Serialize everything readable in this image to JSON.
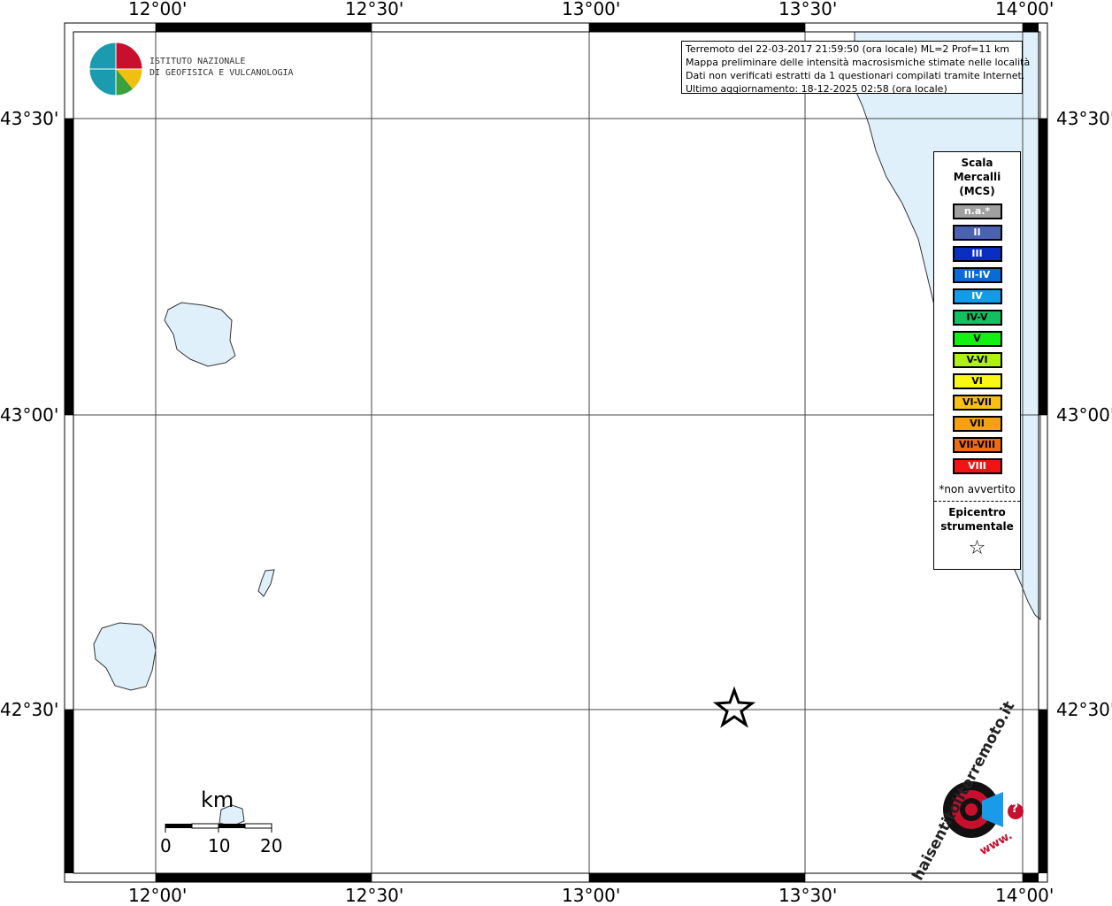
{
  "map": {
    "top_labels": [
      "12°00'",
      "12°30'",
      "13°00'",
      "13°30'",
      "14°00'"
    ],
    "bottom_labels": [
      "12°00'",
      "12°30'",
      "13°00'",
      "13°30'",
      "14°00'"
    ],
    "left_labels": [
      "43°30'",
      "43°00'",
      "42°30'"
    ],
    "right_labels": [
      "43°30'",
      "43°00'",
      "42°30'"
    ],
    "sea_color": "#e0f0fa",
    "grid_color": "#444444"
  },
  "info": {
    "line1": "Terremoto del 22-03-2017 21:59:50 (ora locale) ML=2 Prof=11 km",
    "line2": "Mappa preliminare delle intensità macrosismiche stimate nelle località",
    "line3": "Dati non verificati estratti da 1 questionari compilati tramite Internet.",
    "line4": "Ultimo aggiornamento: 18-12-2025 02:58 (ora locale)"
  },
  "logo": {
    "line1": "ISTITUTO NAZIONALE",
    "line2": "DI GEOFISICA E VULCANOLOGIA"
  },
  "legend": {
    "title1": "Scala",
    "title2": "Mercalli",
    "title3": "(MCS)",
    "items": [
      {
        "label": "n.a.*",
        "color": "#a0a0a0",
        "text_color": "#ffffff"
      },
      {
        "label": "II",
        "color": "#4a62b0",
        "text_color": "#ffffff"
      },
      {
        "label": "III",
        "color": "#0a2fc0",
        "text_color": "#ffffff"
      },
      {
        "label": "III-IV",
        "color": "#0a6ad8",
        "text_color": "#ffffff"
      },
      {
        "label": "IV",
        "color": "#129be8",
        "text_color": "#ffffff"
      },
      {
        "label": "IV-V",
        "color": "#12c060",
        "text_color": "#000000"
      },
      {
        "label": "V",
        "color": "#14f014",
        "text_color": "#000000"
      },
      {
        "label": "V-VI",
        "color": "#b0f014",
        "text_color": "#000000"
      },
      {
        "label": "VI",
        "color": "#f8f814",
        "text_color": "#000000"
      },
      {
        "label": "VI-VII",
        "color": "#f8c014",
        "text_color": "#000000"
      },
      {
        "label": "VII",
        "color": "#f8a014",
        "text_color": "#000000"
      },
      {
        "label": "VII-VIII",
        "color": "#f06a14",
        "text_color": "#000000"
      },
      {
        "label": "VIII",
        "color": "#f01414",
        "text_color": "#ffffff"
      }
    ],
    "note": "*non avvertito",
    "epi1": "Epicentro",
    "epi2": "strumentale",
    "epi_symbol": "☆"
  },
  "scale": {
    "unit": "km",
    "ticks": [
      "0",
      "10",
      "20"
    ]
  },
  "brand": {
    "text": "haisentitoilterremoto.it",
    "url": "www.",
    "question": "?"
  }
}
